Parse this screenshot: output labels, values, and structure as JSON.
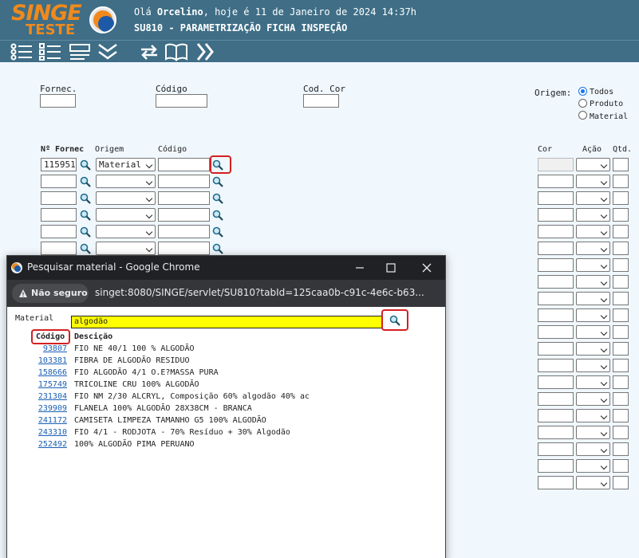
{
  "header": {
    "logo_main": "SINGE",
    "logo_sub": "TESTE",
    "greeting_prefix": "Olá ",
    "user_name": "Orcelino",
    "greeting_suffix": ", hoje é 11 de Janeiro de 2024 14:37h",
    "program_title": "SU810 - PARAMETRIZAÇÃO FICHA INSPEÇÃO"
  },
  "toolbar": {
    "icons": [
      "list-detail-icon",
      "checklist-icon",
      "form-icon",
      "double-chevron-down-icon",
      "refresh-icon",
      "book-icon",
      "double-chevron-right-icon"
    ]
  },
  "filters": {
    "fornec_label": "Fornec.",
    "codigo_label": "Código",
    "codcor_label": "Cod. Cor",
    "origem_label": "Origem:",
    "origem_options": [
      "Todos",
      "Produto",
      "Material"
    ],
    "origem_selected": "Todos"
  },
  "grid": {
    "headers": {
      "nfornec": "Nº Fornec",
      "origem": "Origem",
      "codigo": "Código",
      "cor": "Cor",
      "acao": "Ação",
      "qtd": "Qtd."
    },
    "first_row": {
      "nfornec": "115951",
      "origem": "Material"
    }
  },
  "popup": {
    "window_title": "Pesquisar material - Google Chrome",
    "security_label": "Não seguro",
    "url": "singet:8080/SINGE/servlet/SU810?tabId=125caa0b-c91c-4e6c-b63...",
    "material_label": "Material",
    "search_value": "algodão",
    "col_code": "Código",
    "col_desc": "Descição",
    "results": [
      {
        "code": "93807",
        "desc": "FIO NE 40/1 100 % ALGODÃO"
      },
      {
        "code": "103381",
        "desc": "FIBRA DE ALGODÃO RESIDUO"
      },
      {
        "code": "158666",
        "desc": "FIO ALGODÃO 4/1 O.E?MASSA PURA"
      },
      {
        "code": "175749",
        "desc": "TRICOLINE CRU 100% ALGODÃO"
      },
      {
        "code": "231304",
        "desc": "FIO NM 2/30 ALCRYL, Composição 60% algodão 40% ac"
      },
      {
        "code": "239909",
        "desc": "FLANELA 100% ALGODÃO 28X38CM - BRANCA"
      },
      {
        "code": "241172",
        "desc": "CAMISETA LIMPEZA TAMANHO G5 100% ALGODÃO"
      },
      {
        "code": "243310",
        "desc": "FIO 4/1 - RODJOTA - 70% Resíduo + 30% Algodão"
      },
      {
        "code": "252492",
        "desc": "100% ALGODÃO PIMA PERUANO"
      }
    ]
  }
}
